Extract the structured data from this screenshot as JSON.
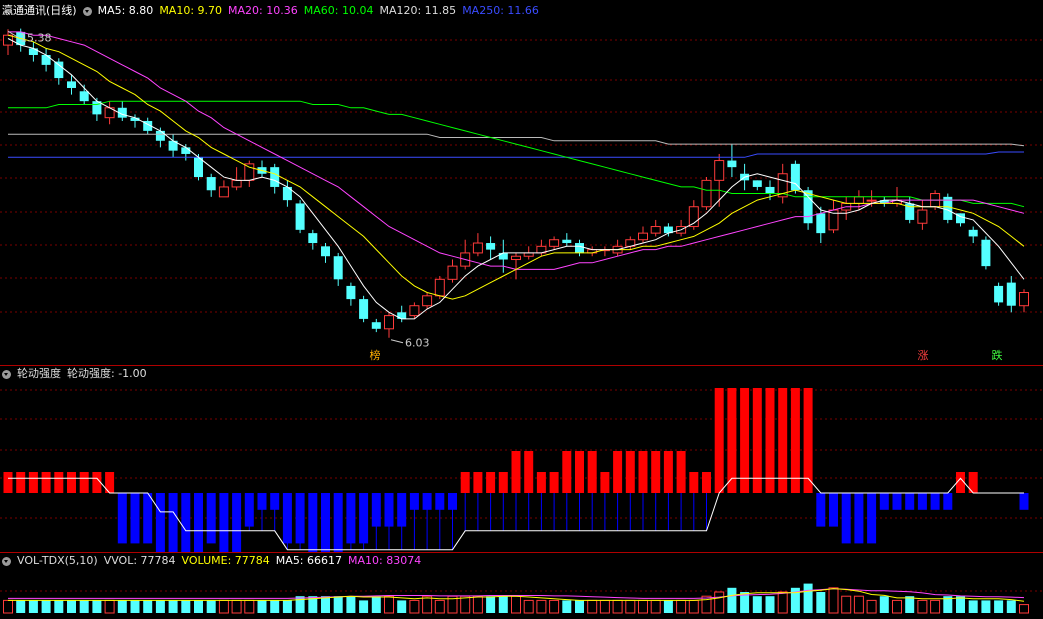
{
  "main": {
    "stock_name": "瀛通通讯(日线)",
    "legend": [
      {
        "label": "MA5: 8.80",
        "color": "#ffffff"
      },
      {
        "label": "MA10: 9.70",
        "color": "#ffff00"
      },
      {
        "label": "MA20: 10.36",
        "color": "#ff44ff"
      },
      {
        "label": "MA60: 10.04",
        "color": "#00ff00"
      },
      {
        "label": "MA120: 11.85",
        "color": "#dddddd"
      },
      {
        "label": "MA250: 11.66",
        "color": "#3a4cff"
      }
    ],
    "high_label": "15.38",
    "low_label": "6.03",
    "tags": [
      {
        "text": "榜",
        "color": "#ffb000"
      },
      {
        "text": "涨",
        "color": "#ff4040"
      },
      {
        "text": "跌",
        "color": "#40ff40"
      }
    ],
    "colors": {
      "up": "#ff3b3b",
      "down": "#54ffff",
      "grid": "#7a0000"
    }
  },
  "indicator": {
    "name": "轮动强度",
    "value_label": "轮动强度: -1.00",
    "colors": {
      "positive": "#ff0000",
      "negative": "#0000ff",
      "line": "#ffffff"
    }
  },
  "volume": {
    "name": "VOL-TDX(5,10)",
    "legend": [
      {
        "label": "VVOL: 77784",
        "color": "#dddddd"
      },
      {
        "label": "VOLUME: 77784",
        "color": "#ffff00"
      },
      {
        "label": "MA5: 66617",
        "color": "#ffffff"
      },
      {
        "label": "MA10: 83074",
        "color": "#ff44ff"
      }
    ]
  },
  "chart_data": {
    "type": "candlestick",
    "candles": [
      [
        14.9,
        15.2,
        15.38,
        14.6
      ],
      [
        15.3,
        14.9,
        15.4,
        14.7
      ],
      [
        14.8,
        14.6,
        15.0,
        14.4
      ],
      [
        14.6,
        14.3,
        14.8,
        14.1
      ],
      [
        14.4,
        13.9,
        14.5,
        13.7
      ],
      [
        13.8,
        13.6,
        14.0,
        13.4
      ],
      [
        13.5,
        13.2,
        13.7,
        13.1
      ],
      [
        13.2,
        12.8,
        13.3,
        12.6
      ],
      [
        12.7,
        13.0,
        13.2,
        12.5
      ],
      [
        13.0,
        12.7,
        13.2,
        12.6
      ],
      [
        12.7,
        12.6,
        12.8,
        12.4
      ],
      [
        12.6,
        12.3,
        12.7,
        12.2
      ],
      [
        12.3,
        12.0,
        12.4,
        11.8
      ],
      [
        12.0,
        11.7,
        12.2,
        11.5
      ],
      [
        11.8,
        11.6,
        11.9,
        11.4
      ],
      [
        11.5,
        10.9,
        11.6,
        10.8
      ],
      [
        10.9,
        10.5,
        11.0,
        10.3
      ],
      [
        10.3,
        10.6,
        10.8,
        10.3
      ],
      [
        10.6,
        10.8,
        11.2,
        10.5
      ],
      [
        10.8,
        11.3,
        11.4,
        10.6
      ],
      [
        11.2,
        11.0,
        11.4,
        10.9
      ],
      [
        11.2,
        10.6,
        11.3,
        10.4
      ],
      [
        10.6,
        10.2,
        10.8,
        10.0
      ],
      [
        10.1,
        9.3,
        10.2,
        9.2
      ],
      [
        9.2,
        8.9,
        9.3,
        8.7
      ],
      [
        8.8,
        8.5,
        8.9,
        8.3
      ],
      [
        8.5,
        7.8,
        8.6,
        7.6
      ],
      [
        7.6,
        7.2,
        7.7,
        7.0
      ],
      [
        7.2,
        6.6,
        7.3,
        6.5
      ],
      [
        6.5,
        6.3,
        6.6,
        6.2
      ],
      [
        6.3,
        6.7,
        6.8,
        6.03
      ],
      [
        6.8,
        6.6,
        7.0,
        6.5
      ],
      [
        6.7,
        7.0,
        7.1,
        6.6
      ],
      [
        7.0,
        7.3,
        7.4,
        6.9
      ],
      [
        7.3,
        7.8,
        7.9,
        7.2
      ],
      [
        7.8,
        8.2,
        8.4,
        7.7
      ],
      [
        8.2,
        8.6,
        9.0,
        8.1
      ],
      [
        8.6,
        8.9,
        9.2,
        8.5
      ],
      [
        8.9,
        8.7,
        9.1,
        8.4
      ],
      [
        8.6,
        8.4,
        9.0,
        8.0
      ],
      [
        8.4,
        8.5,
        8.6,
        7.8
      ],
      [
        8.5,
        8.6,
        8.8,
        8.4
      ],
      [
        8.6,
        8.8,
        9.0,
        8.5
      ],
      [
        8.8,
        9.0,
        9.1,
        8.7
      ],
      [
        9.0,
        8.9,
        9.2,
        8.8
      ],
      [
        8.9,
        8.6,
        9.0,
        8.5
      ],
      [
        8.6,
        8.7,
        8.8,
        8.5
      ],
      [
        8.7,
        8.7,
        8.8,
        8.5
      ],
      [
        8.6,
        8.8,
        9.0,
        8.5
      ],
      [
        8.8,
        9.0,
        9.1,
        8.7
      ],
      [
        9.0,
        9.2,
        9.4,
        8.9
      ],
      [
        9.2,
        9.4,
        9.6,
        9.1
      ],
      [
        9.4,
        9.2,
        9.5,
        9.1
      ],
      [
        9.2,
        9.4,
        9.6,
        9.1
      ],
      [
        9.4,
        10.0,
        10.2,
        9.3
      ],
      [
        10.0,
        10.8,
        10.9,
        9.9
      ],
      [
        10.8,
        11.4,
        11.6,
        10.0
      ],
      [
        11.4,
        11.2,
        11.9,
        10.9
      ],
      [
        11.0,
        10.8,
        11.3,
        10.5
      ],
      [
        10.8,
        10.6,
        10.8,
        10.5
      ],
      [
        10.6,
        10.4,
        10.8,
        10.2
      ],
      [
        10.3,
        11.0,
        11.3,
        10.1
      ],
      [
        11.3,
        10.5,
        11.4,
        10.4
      ],
      [
        10.5,
        9.5,
        10.6,
        9.3
      ],
      [
        9.8,
        9.2,
        10.0,
        8.9
      ],
      [
        9.3,
        9.9,
        10.2,
        9.2
      ],
      [
        9.9,
        10.1,
        10.3,
        9.6
      ],
      [
        10.1,
        10.3,
        10.5,
        9.9
      ],
      [
        10.2,
        10.2,
        10.5,
        10.0
      ],
      [
        10.2,
        10.1,
        10.3,
        10.0
      ],
      [
        10.1,
        10.2,
        10.6,
        10.0
      ],
      [
        10.1,
        9.6,
        10.3,
        9.5
      ],
      [
        9.5,
        9.9,
        10.2,
        9.3
      ],
      [
        10.0,
        10.4,
        10.5,
        9.9
      ],
      [
        10.3,
        9.6,
        10.4,
        9.5
      ],
      [
        9.8,
        9.5,
        9.8,
        9.4
      ],
      [
        9.3,
        9.1,
        9.4,
        8.9
      ],
      [
        9.0,
        8.2,
        9.1,
        8.1
      ],
      [
        7.6,
        7.1,
        7.7,
        7.0
      ],
      [
        7.7,
        7.0,
        7.9,
        6.8
      ],
      [
        7.0,
        7.4,
        7.5,
        6.8
      ]
    ],
    "ma5": [
      15.1,
      14.9,
      14.8,
      14.6,
      14.3,
      14.0,
      13.6,
      13.2,
      13.0,
      12.8,
      12.7,
      12.5,
      12.3,
      12.0,
      11.8,
      11.5,
      11.2,
      10.9,
      10.8,
      10.8,
      10.9,
      10.8,
      10.6,
      10.3,
      9.8,
      9.3,
      8.8,
      8.2,
      7.6,
      7.1,
      6.8,
      6.6,
      6.6,
      6.9,
      7.1,
      7.5,
      7.9,
      8.2,
      8.4,
      8.6,
      8.6,
      8.6,
      8.6,
      8.7,
      8.8,
      8.8,
      8.7,
      8.7,
      8.7,
      8.8,
      8.9,
      9.0,
      9.2,
      9.3,
      9.5,
      9.8,
      10.2,
      10.6,
      10.9,
      11.0,
      10.9,
      10.8,
      10.7,
      10.3,
      9.9,
      9.8,
      9.8,
      9.9,
      10.1,
      10.2,
      10.2,
      10.1,
      10.0,
      10.0,
      9.9,
      9.7,
      9.6,
      9.2,
      8.8,
      8.3,
      7.8
    ],
    "ma10": [
      15.2,
      15.1,
      15.0,
      14.8,
      14.7,
      14.5,
      14.3,
      14.1,
      13.8,
      13.6,
      13.4,
      13.1,
      12.9,
      12.6,
      12.3,
      12.1,
      11.8,
      11.6,
      11.4,
      11.2,
      11.1,
      11.0,
      10.8,
      10.6,
      10.3,
      10.0,
      9.7,
      9.4,
      9.1,
      8.7,
      8.3,
      7.9,
      7.6,
      7.4,
      7.3,
      7.2,
      7.3,
      7.5,
      7.7,
      7.9,
      8.1,
      8.3,
      8.5,
      8.6,
      8.6,
      8.6,
      8.6,
      8.7,
      8.7,
      8.7,
      8.8,
      8.8,
      8.9,
      9.0,
      9.1,
      9.3,
      9.5,
      9.8,
      10.0,
      10.2,
      10.3,
      10.4,
      10.5,
      10.4,
      10.3,
      10.2,
      10.1,
      10.1,
      10.1,
      10.1,
      10.1,
      10.0,
      10.0,
      10.0,
      10.0,
      9.9,
      9.8,
      9.6,
      9.4,
      9.1,
      8.8
    ],
    "ma20": [
      15.3,
      15.3,
      15.2,
      15.2,
      15.1,
      15.0,
      14.9,
      14.7,
      14.5,
      14.3,
      14.1,
      13.9,
      13.6,
      13.4,
      13.2,
      12.9,
      12.7,
      12.4,
      12.2,
      12.0,
      11.8,
      11.6,
      11.4,
      11.2,
      11.0,
      10.8,
      10.6,
      10.3,
      10.0,
      9.7,
      9.4,
      9.2,
      9.0,
      8.8,
      8.6,
      8.5,
      8.4,
      8.3,
      8.2,
      8.2,
      8.1,
      8.1,
      8.1,
      8.1,
      8.2,
      8.3,
      8.3,
      8.4,
      8.5,
      8.6,
      8.7,
      8.7,
      8.8,
      8.8,
      8.9,
      9.0,
      9.1,
      9.2,
      9.3,
      9.4,
      9.5,
      9.6,
      9.7,
      9.7,
      9.8,
      9.9,
      10.0,
      10.0,
      10.1,
      10.1,
      10.2,
      10.2,
      10.2,
      10.2,
      10.2,
      10.2,
      10.2,
      10.1,
      10.0,
      9.9,
      9.8
    ],
    "ma60": [
      13.0,
      13.0,
      13.0,
      13.0,
      13.1,
      13.1,
      13.1,
      13.1,
      13.2,
      13.2,
      13.2,
      13.2,
      13.2,
      13.2,
      13.2,
      13.2,
      13.2,
      13.2,
      13.2,
      13.2,
      13.2,
      13.2,
      13.2,
      13.2,
      13.1,
      13.1,
      13.1,
      13.0,
      13.0,
      12.9,
      12.8,
      12.8,
      12.7,
      12.6,
      12.5,
      12.4,
      12.3,
      12.2,
      12.1,
      12.0,
      11.9,
      11.8,
      11.7,
      11.6,
      11.5,
      11.4,
      11.3,
      11.2,
      11.1,
      11.0,
      10.9,
      10.8,
      10.7,
      10.6,
      10.6,
      10.5,
      10.5,
      10.4,
      10.4,
      10.4,
      10.4,
      10.4,
      10.3,
      10.3,
      10.3,
      10.3,
      10.3,
      10.3,
      10.3,
      10.3,
      10.3,
      10.3,
      10.2,
      10.2,
      10.2,
      10.2,
      10.1,
      10.1,
      10.1,
      10.1,
      10.0
    ],
    "ma120": [
      12.2,
      12.2,
      12.2,
      12.2,
      12.2,
      12.2,
      12.2,
      12.2,
      12.2,
      12.2,
      12.2,
      12.2,
      12.2,
      12.2,
      12.2,
      12.2,
      12.2,
      12.2,
      12.2,
      12.2,
      12.2,
      12.2,
      12.2,
      12.2,
      12.2,
      12.2,
      12.2,
      12.2,
      12.2,
      12.2,
      12.2,
      12.2,
      12.2,
      12.2,
      12.1,
      12.1,
      12.1,
      12.1,
      12.1,
      12.1,
      12.1,
      12.1,
      12.1,
      12.0,
      12.0,
      12.0,
      12.0,
      12.0,
      12.0,
      12.0,
      12.0,
      12.0,
      11.9,
      11.9,
      11.9,
      11.9,
      11.9,
      11.9,
      11.9,
      11.9,
      11.9,
      11.9,
      11.9,
      11.9,
      11.9,
      11.9,
      11.9,
      11.9,
      11.9,
      11.9,
      11.9,
      11.9,
      11.9,
      11.9,
      11.9,
      11.9,
      11.9,
      11.9,
      11.9,
      11.9,
      11.85
    ],
    "ma250": [
      11.5,
      11.5,
      11.5,
      11.5,
      11.5,
      11.5,
      11.5,
      11.5,
      11.5,
      11.5,
      11.5,
      11.5,
      11.5,
      11.5,
      11.5,
      11.5,
      11.5,
      11.5,
      11.5,
      11.5,
      11.5,
      11.5,
      11.5,
      11.5,
      11.5,
      11.5,
      11.5,
      11.5,
      11.5,
      11.5,
      11.5,
      11.5,
      11.5,
      11.5,
      11.5,
      11.5,
      11.5,
      11.5,
      11.5,
      11.5,
      11.5,
      11.5,
      11.5,
      11.5,
      11.5,
      11.5,
      11.5,
      11.5,
      11.5,
      11.5,
      11.5,
      11.5,
      11.5,
      11.5,
      11.5,
      11.5,
      11.5,
      11.5,
      11.5,
      11.6,
      11.6,
      11.6,
      11.6,
      11.6,
      11.6,
      11.6,
      11.6,
      11.6,
      11.6,
      11.6,
      11.6,
      11.6,
      11.6,
      11.6,
      11.6,
      11.6,
      11.6,
      11.6,
      11.66,
      11.66,
      11.66
    ],
    "indicator": [
      1,
      1,
      1,
      1,
      1,
      1,
      1,
      1,
      1,
      -3,
      -3,
      -3,
      -5,
      -5,
      -6,
      -6,
      -3,
      -4,
      -5,
      -2,
      -1,
      -1,
      -3,
      -3,
      -5,
      -5,
      -4,
      -3,
      -3,
      -2,
      -2,
      -2,
      -1,
      -1,
      -1,
      -1,
      1,
      1,
      1,
      1,
      2,
      2,
      1,
      1,
      2,
      2,
      2,
      1,
      2,
      2,
      2,
      2,
      2,
      2,
      1,
      1,
      5,
      5,
      5,
      5,
      5,
      5,
      5,
      5,
      -2,
      -2,
      -3,
      -3,
      -3,
      -1,
      -1,
      -1,
      -1,
      -1,
      -1,
      1,
      1,
      0,
      0,
      0,
      -1
    ],
    "indicator_line": [
      1,
      1,
      1,
      1,
      1,
      1,
      1,
      1,
      0,
      0,
      0,
      0,
      -1,
      -1,
      -2,
      -2,
      -2,
      -2,
      -2,
      -2,
      -2,
      -2,
      -3,
      -3,
      -3,
      -3,
      -3,
      -3,
      -3,
      -3,
      -3,
      -3,
      -3,
      -3,
      -3,
      -3,
      -2,
      -2,
      -2,
      -2,
      -2,
      -2,
      -2,
      -2,
      -2,
      -2,
      -2,
      -2,
      -2,
      -2,
      -2,
      -2,
      -2,
      -2,
      -2,
      -2,
      0,
      1,
      1,
      1,
      1,
      1,
      1,
      1,
      0,
      0,
      0,
      0,
      0,
      0,
      0,
      0,
      0,
      0,
      0,
      1,
      0,
      0,
      0,
      0,
      0
    ],
    "volume": [
      3,
      3,
      3,
      3,
      3,
      3,
      3,
      3,
      3,
      3,
      3,
      3,
      3,
      3,
      3,
      3,
      3,
      3,
      3,
      3,
      3,
      3,
      3,
      4,
      4,
      4,
      4,
      4,
      3,
      4,
      4,
      3,
      3,
      4,
      3,
      4,
      4,
      4,
      4,
      4,
      4,
      3,
      3,
      3,
      3,
      3,
      3,
      3,
      3,
      3,
      3,
      3,
      3,
      3,
      3,
      4,
      5,
      6,
      5,
      4,
      4,
      5,
      6,
      7,
      5,
      6,
      4,
      4,
      3,
      4,
      3,
      4,
      3,
      3,
      4,
      4,
      3,
      3,
      3,
      3,
      2
    ]
  }
}
